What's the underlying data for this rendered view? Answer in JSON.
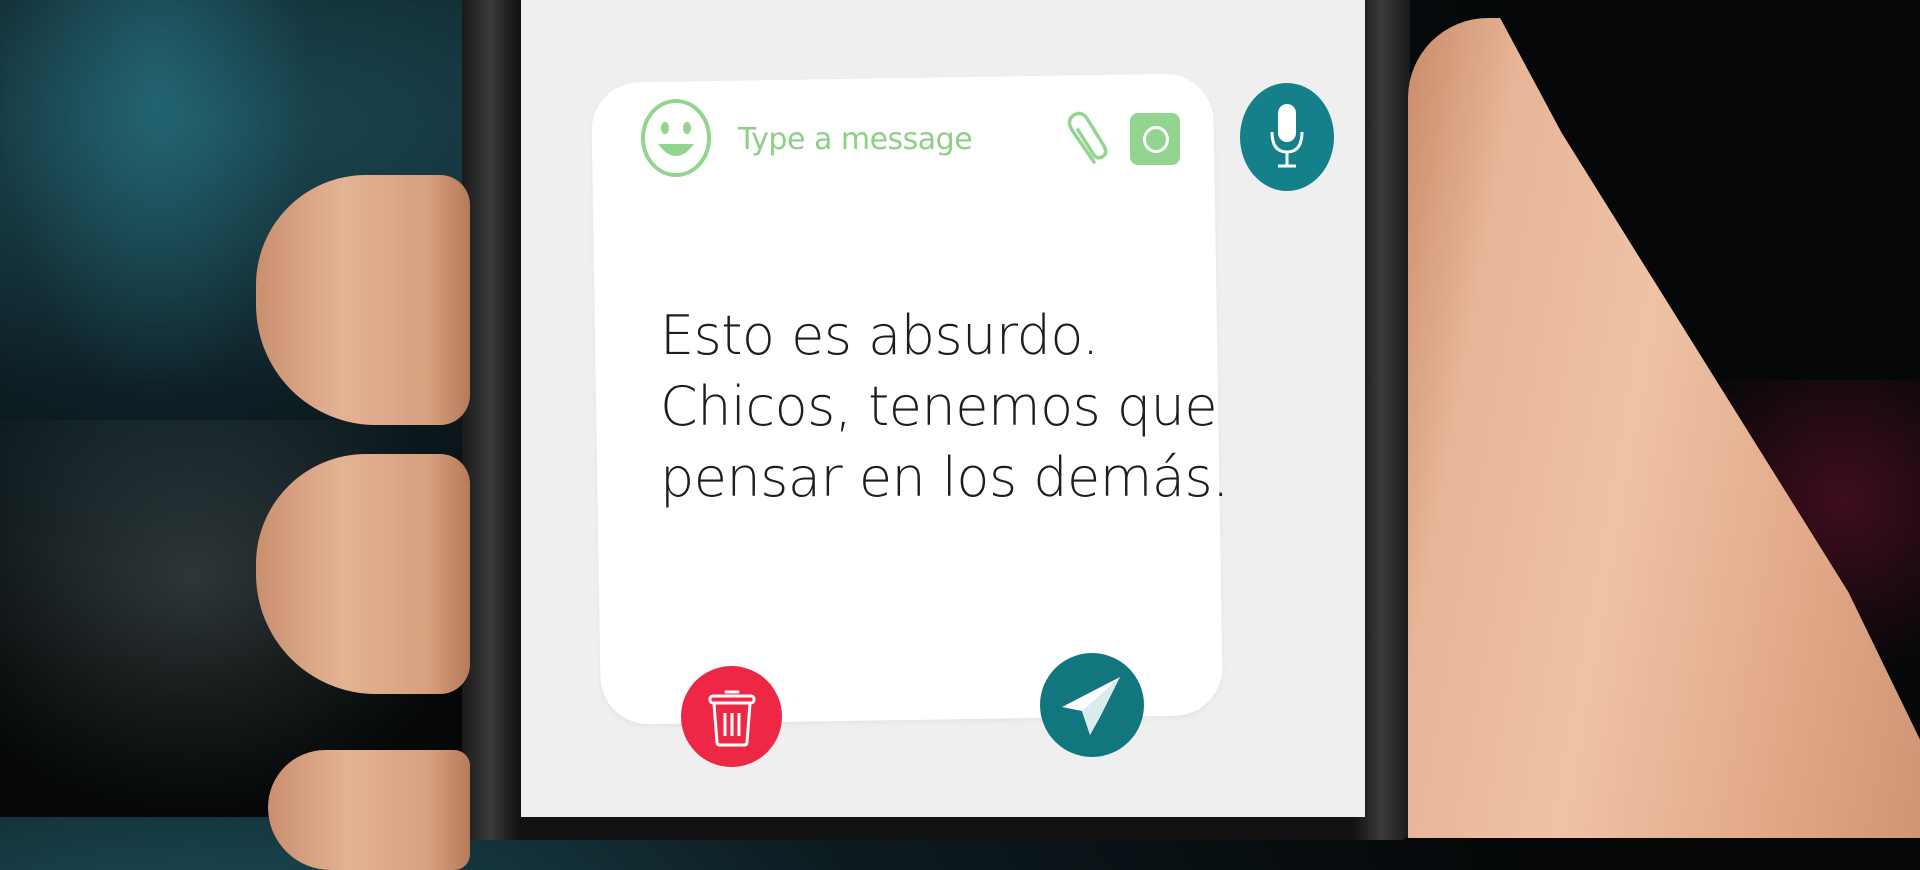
{
  "composer": {
    "emoji_icon": "smiley-face-icon",
    "placeholder": "Type a message",
    "attach_icon": "paperclip-icon",
    "camera_icon": "camera-icon",
    "mic_icon": "microphone-icon"
  },
  "message": {
    "lines": [
      "Esto es absurdo.",
      "Chicos, tenemos que",
      "pensar en los demás."
    ]
  },
  "actions": {
    "delete_icon": "trash-icon",
    "send_icon": "paper-plane-icon"
  },
  "colors": {
    "accent_green": "#93d58e",
    "mic_teal": "#13808a",
    "send_teal": "#12767f",
    "delete_red": "#ee2745",
    "text": "#1e1e1e"
  }
}
